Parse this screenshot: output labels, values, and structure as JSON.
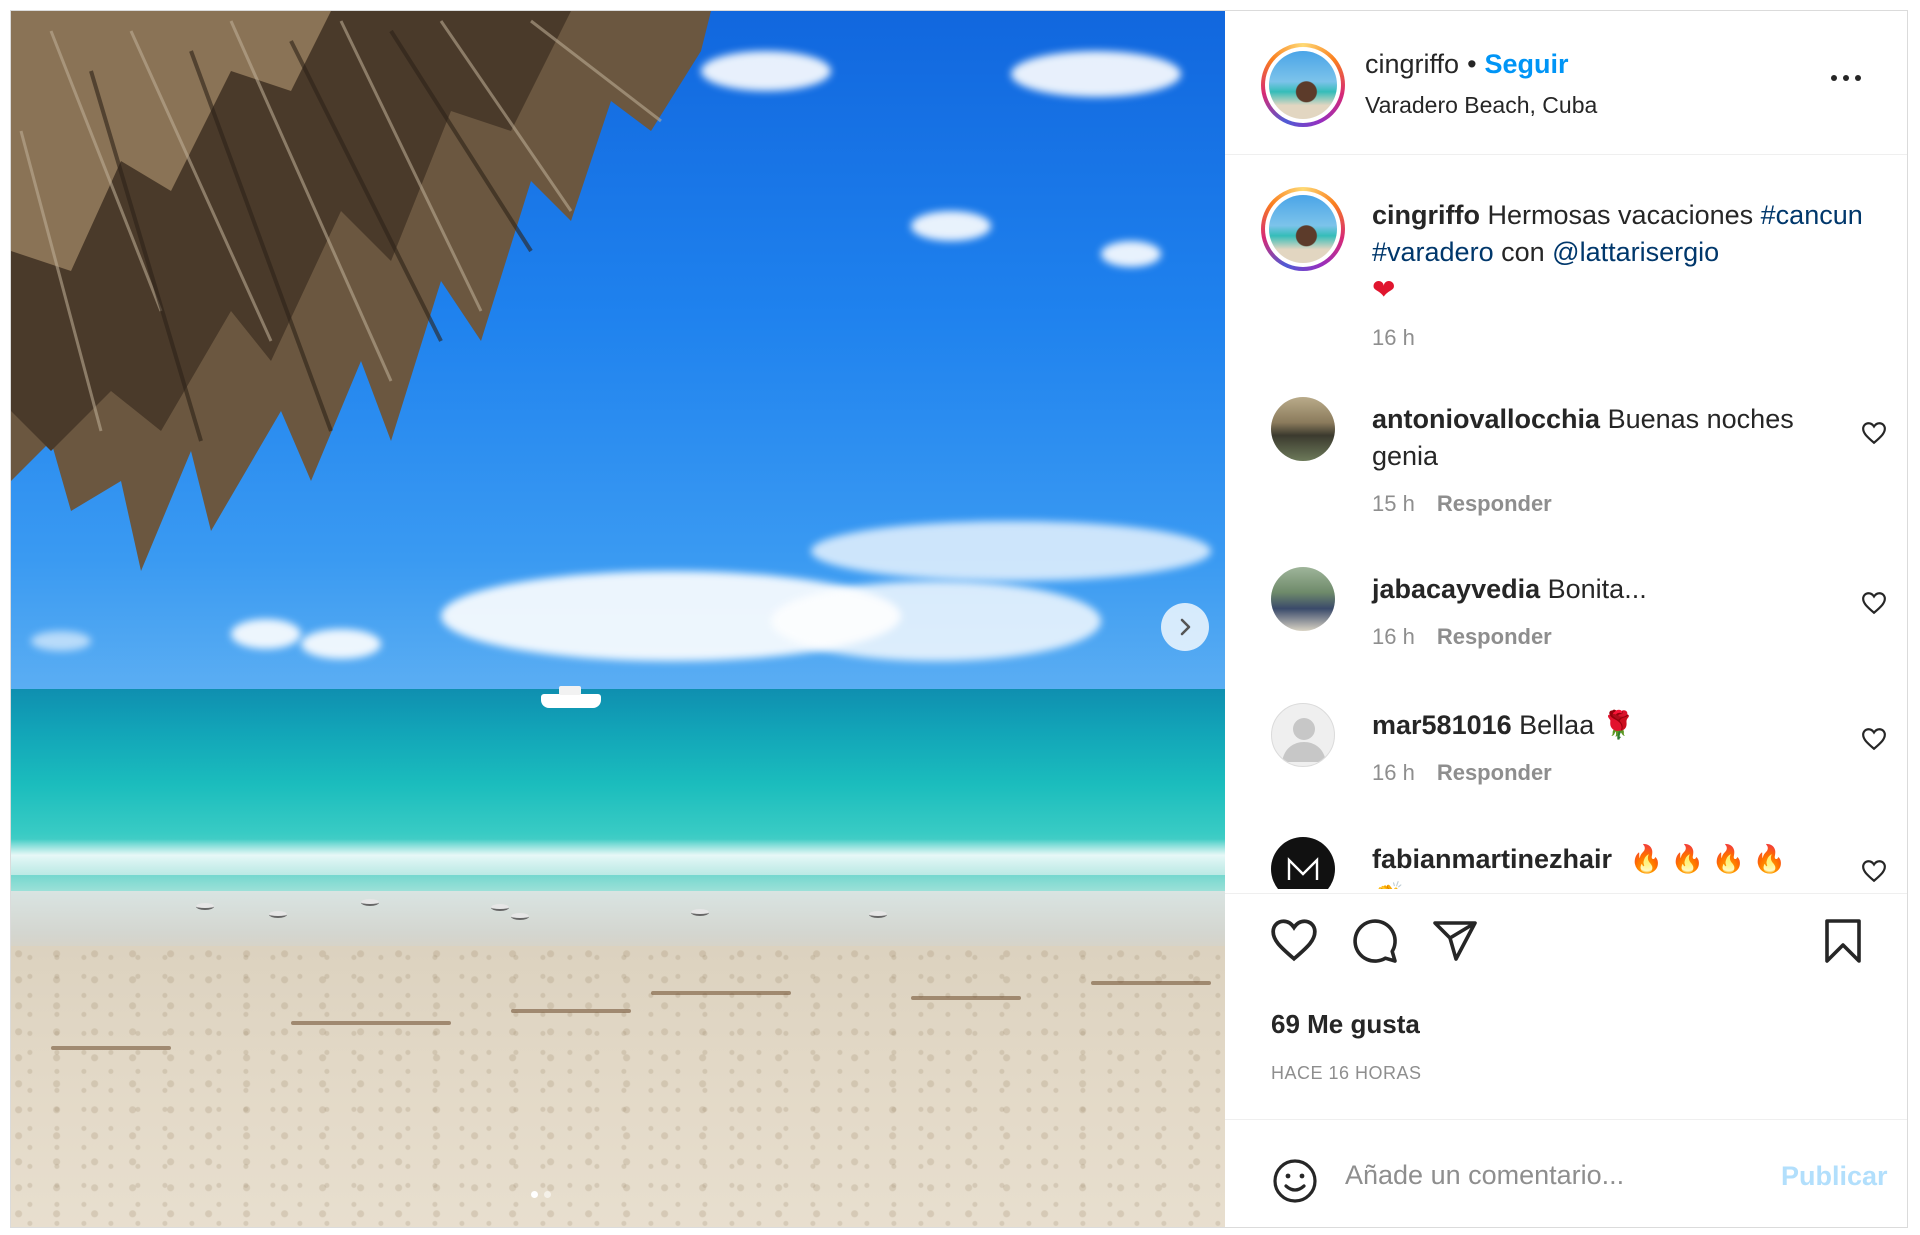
{
  "post": {
    "author": "cingriffo",
    "separator": "•",
    "follow_label": "Seguir",
    "location": "Varadero Beach, Cuba",
    "more_icon": "more-horizontal-icon"
  },
  "caption": {
    "author": "cingriffo",
    "text_plain": "Hermosas vacaciones",
    "hashtag_1": "#cancun",
    "hashtag_2": "#varadero",
    "connector": "con",
    "mention": "@lattarisergio",
    "emoji": "❤",
    "time": "16 h"
  },
  "comments": [
    {
      "user": "antoniovallocchia",
      "text": "Buenas noches genia",
      "time": "15 h",
      "reply": "Responder"
    },
    {
      "user": "jabacayvedia",
      "text": "Bonita...",
      "time": "16 h",
      "reply": "Responder"
    },
    {
      "user": "mar581016",
      "text": "Bellaa 🌹",
      "time": "16 h",
      "reply": "Responder"
    },
    {
      "user": "fabianmartinezhair",
      "text": "🔥 🔥 🔥 🔥 👏"
    }
  ],
  "likes_text": "69 Me gusta",
  "time_ago": "HACE 16 HORAS",
  "add_comment": {
    "placeholder": "Añade un comentario...",
    "publish_label": "Publicar"
  },
  "colors": {
    "link_blue": "#0095f6",
    "mention_blue": "#00376b",
    "muted": "#8e8e8e",
    "publish_disabled": "#b2dffc"
  }
}
